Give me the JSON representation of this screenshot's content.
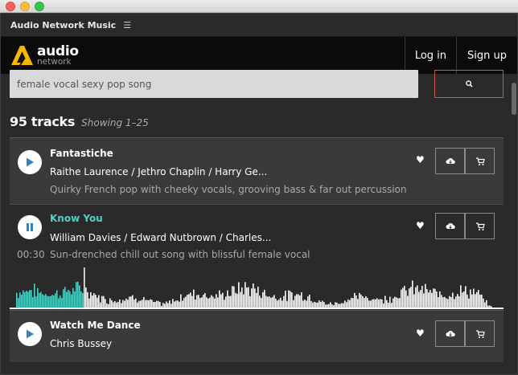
{
  "window": {
    "app_title": "Audio Network Music",
    "menu_icon": "hamburger-icon"
  },
  "header": {
    "logo_text_line1": "audio",
    "logo_text_line2": "network",
    "login_label": "Log in",
    "signup_label": "Sign up"
  },
  "search": {
    "value": "female vocal sexy pop song",
    "button_icon": "search-icon"
  },
  "results": {
    "count_label": "95 tracks",
    "showing_label": "Showing 1–25"
  },
  "tracks": [
    {
      "title": "Fantastiche",
      "artists": "Raithe Laurence / Jethro Chaplin / Harry Ge...",
      "description": "Quirky French pop with cheeky vocals, grooving bass & far out percussion",
      "state": "play"
    },
    {
      "title": "Know You",
      "artists": "William Davies / Edward Nutbrown / Charles...",
      "description": "Sun-drenched chill out song with blissful female vocal",
      "time": "00:30",
      "state": "pause",
      "progress": 0.15
    },
    {
      "title": "Watch Me Dance",
      "artists": "Chris Bussey",
      "state": "play"
    }
  ],
  "colors": {
    "accent": "#4fd1c5",
    "play_icon": "#2e86c1",
    "search_border": "#d9534f",
    "logo_yellow": "#f5b700"
  }
}
